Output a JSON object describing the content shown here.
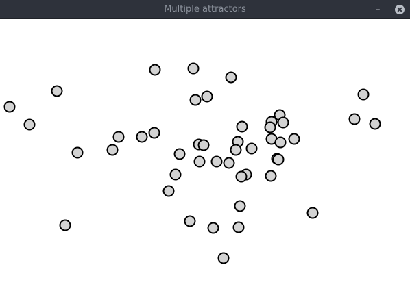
{
  "window": {
    "title": "Multiple attractors",
    "minimize_glyph": "–",
    "close_icon": "close-circle-icon"
  },
  "colors": {
    "titlebar": "#2e323b",
    "title_text": "#8c929c",
    "canvas_bg": "#ffffff",
    "particle_fill": "#d3d3d3",
    "particle_stroke": "#000000"
  }
}
